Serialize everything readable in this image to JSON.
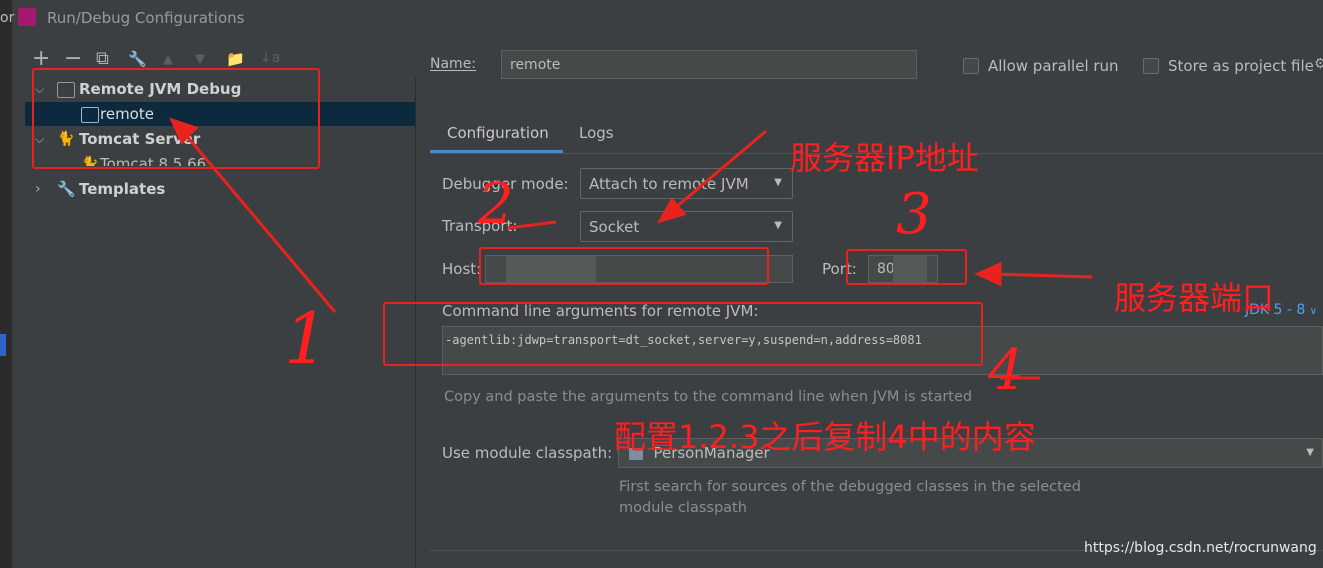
{
  "window": {
    "title": "Run/Debug Configurations"
  },
  "left_edge": {
    "fragment": "or"
  },
  "toolbar": {
    "add": "+",
    "remove": "−",
    "copy": "⧉",
    "edit": "🔧",
    "up": "▲",
    "down": "▼",
    "folder": "📁",
    "sort": "↓a"
  },
  "tree": [
    {
      "label": "Remote JVM Debug",
      "expanded": true
    },
    {
      "label": "remote",
      "selected": true
    },
    {
      "label": "Tomcat Server",
      "expanded": true
    },
    {
      "label": "Tomcat 8.5.66"
    },
    {
      "label": "Templates",
      "expanded": false
    }
  ],
  "header": {
    "name_label": "Name:",
    "name_value": "remote",
    "allow_parallel": "Allow parallel run",
    "store_as_file": "Store as project file"
  },
  "tabs": [
    {
      "label": "Configuration",
      "active": true
    },
    {
      "label": "Logs",
      "active": false
    }
  ],
  "form": {
    "debugger_mode_label": "Debugger mode:",
    "debugger_mode_value": "Attach to remote JVM",
    "transport_label": "Transport:",
    "transport_value": "Socket",
    "host_label": "Host:",
    "host_value": "",
    "port_label": "Port:",
    "port_value": "80",
    "cmd_label": "Command line arguments for remote JVM:",
    "jdk_link": "JDK 5 - 8",
    "cmd_value": "-agentlib:jdwp=transport=dt_socket,server=y,suspend=n,address=8081",
    "cmd_hint": "Copy and paste the arguments to the command line when JVM is started",
    "module_label": "Use module classpath:",
    "module_value": "PersonManager",
    "module_hint_1": "First search for sources of the debugged classes in the selected",
    "module_hint_2": "module classpath"
  },
  "annotations": {
    "server_ip": "服务器IP地址",
    "server_port": "服务器端口",
    "config_note": "配置1.2.3之后复制4中的内容",
    "n1": "1",
    "n2": "2",
    "n3": "3",
    "n4": "4"
  },
  "watermark": "https://blog.csdn.net/rocrunwang",
  "colors": {
    "background": "#3c3f41",
    "selection": "#0d293e",
    "accent_tab": "#4a88c7",
    "annotation_red": "#e8231e",
    "link": "#589df6"
  }
}
